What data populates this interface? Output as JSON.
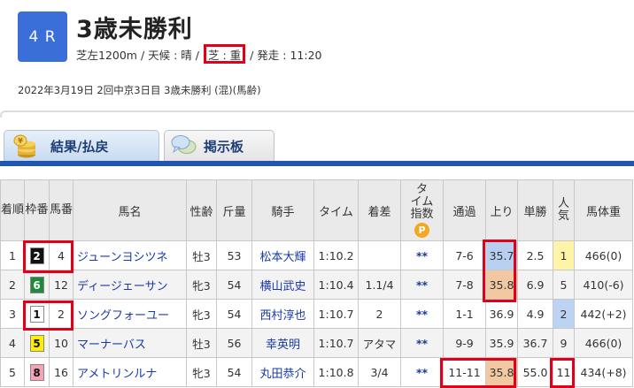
{
  "race": {
    "number": "4 R",
    "title": "3歳未勝利",
    "info_prefix": "芝左1200m / 天候 : 晴 / ",
    "track_condition": "芝 : 重",
    "info_suffix": " / 発走 : 11:20",
    "meta": "2022年3月19日 2回中京3日目 3歳未勝利 (混)(馬齢)"
  },
  "tabs": {
    "result": "結果/払戻",
    "board": "掲示板"
  },
  "table": {
    "headers": {
      "rank": "着順",
      "waku": "枠番",
      "umaban": "馬番",
      "horse": "馬名",
      "sex_age": "性齢",
      "weight": "斤量",
      "jockey": "騎手",
      "time": "タイム",
      "margin": "着差",
      "time_index": "タイム指数",
      "time_index_badge": "P",
      "passing": "通過",
      "last3f": "上り",
      "odds": "単勝",
      "popularity": "人気",
      "body_weight": "馬体重"
    },
    "rows": [
      {
        "rank": "1",
        "waku": "2",
        "umaban": "4",
        "horse": "ジューンヨシツネ",
        "sex_age": "牡3",
        "weight": "53",
        "jockey": "松本大輝",
        "time": "1:10.2",
        "margin": "",
        "time_index": "**",
        "passing": "7-6",
        "last3f": "35.7",
        "odds": "2.5",
        "popularity": "1",
        "body_weight": "466(0)"
      },
      {
        "rank": "2",
        "waku": "6",
        "umaban": "12",
        "horse": "ディージェーサン",
        "sex_age": "牝3",
        "weight": "54",
        "jockey": "横山武史",
        "time": "1:10.4",
        "margin": "1.1/4",
        "time_index": "**",
        "passing": "7-8",
        "last3f": "35.8",
        "odds": "6.9",
        "popularity": "5",
        "body_weight": "410(-6)"
      },
      {
        "rank": "3",
        "waku": "1",
        "umaban": "2",
        "horse": "ソングフォーユー",
        "sex_age": "牝3",
        "weight": "54",
        "jockey": "西村淳也",
        "time": "1:10.7",
        "margin": "2",
        "time_index": "**",
        "passing": "1-1",
        "last3f": "36.9",
        "odds": "4.9",
        "popularity": "2",
        "body_weight": "442(+2)"
      },
      {
        "rank": "4",
        "waku": "5",
        "umaban": "10",
        "horse": "マーナーバス",
        "sex_age": "牡3",
        "weight": "56",
        "jockey": "幸英明",
        "time": "1:10.7",
        "margin": "アタマ",
        "time_index": "**",
        "passing": "9-9",
        "last3f": "35.9",
        "odds": "36.7",
        "popularity": "9",
        "body_weight": "466(0)"
      },
      {
        "rank": "5",
        "waku": "8",
        "umaban": "16",
        "horse": "アメトリンルナ",
        "sex_age": "牝3",
        "weight": "54",
        "jockey": "丸田恭介",
        "time": "1:10.8",
        "margin": "3/4",
        "time_index": "**",
        "passing": "11-11",
        "last3f": "35.8",
        "odds": "55.0",
        "popularity": "11",
        "body_weight": "434(+8)"
      }
    ]
  },
  "colors": {
    "waku_1": "#ffffff",
    "waku_2": "#111111",
    "waku_5": "#fff000",
    "waku_6": "#1d8c3a",
    "waku_8": "#f7a3b5",
    "highlight": "#e0001a",
    "tab_bar": "#1f55b0",
    "race_box": "#3a6fd8"
  },
  "icons": {
    "result_tab": "coins-icon",
    "board_tab": "speech-bubble-icon",
    "time_index": "p-badge-icon"
  }
}
